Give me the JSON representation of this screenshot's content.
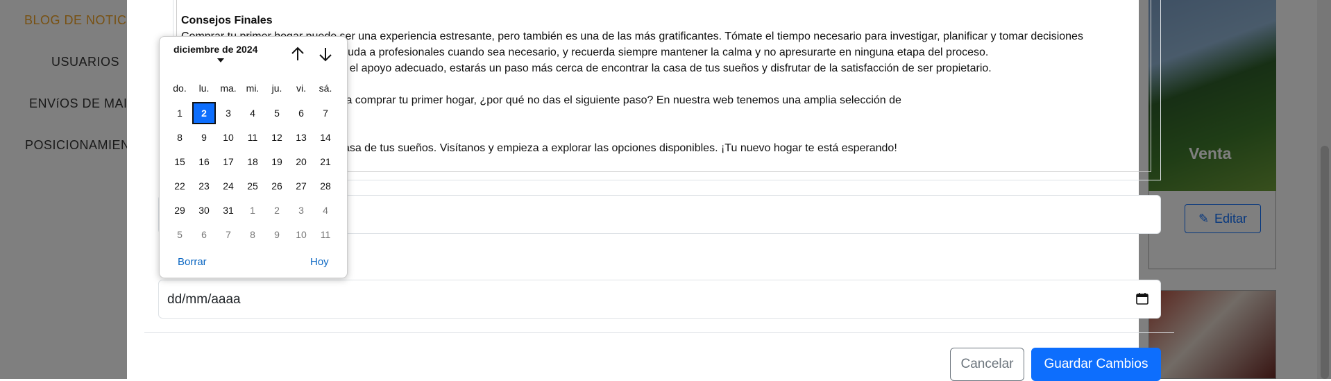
{
  "sidebar": {
    "items": [
      {
        "label": "BLOG DE NOTICIAS",
        "active": true
      },
      {
        "label": "USUARIOS",
        "active": false
      },
      {
        "label": "ENVíOS DE MAIL",
        "active": false
      },
      {
        "label": "POSICIONAMIENTO",
        "active": false
      }
    ]
  },
  "card": {
    "caption": "Venta",
    "edit_label": "Editar"
  },
  "editor": {
    "heading": "Consejos Finales",
    "lines": [
      "Comprar tu primer hogar puede ser una experiencia estresante, pero también es una de las más gratificantes. Tómate el tiempo necesario para investigar, planificar y tomar decisiones",
      "informadas. No dudes en pedir ayuda a profesionales cuando sea necesario, y recuerda siempre mantener la calma y no apresurarte en ninguna etapa del proceso.",
      "Con la información correcta y con el apoyo adecuado, estarás un paso más cerca de encontrar la casa de tus sueños y disfrutar de la satisfacción de ser propietario.",
      "",
      "Si estás listo para dar el paso para comprar tu primer hogar, ¿por qué no das el siguiente paso? En nuestra web tenemos una amplia selección de",
      "",
      "",
      "propiedades que podrían ser la casa de tus sueños. Visítanos y empieza a explorar las opciones disponibles. ¡Tu nuevo hogar te está esperando!"
    ]
  },
  "date_field": {
    "placeholder": "dd/mm/aaaa"
  },
  "footer": {
    "cancel_label": "Cancelar",
    "save_label": "Guardar Cambios"
  },
  "datepicker": {
    "month_label": "diciembre de 2024",
    "weekdays": [
      "do.",
      "lu.",
      "ma.",
      "mi.",
      "ju.",
      "vi.",
      "sá."
    ],
    "weeks": [
      [
        "1",
        "2",
        "3",
        "4",
        "5",
        "6",
        "7"
      ],
      [
        "8",
        "9",
        "10",
        "11",
        "12",
        "13",
        "14"
      ],
      [
        "15",
        "16",
        "17",
        "18",
        "19",
        "20",
        "21"
      ],
      [
        "22",
        "23",
        "24",
        "25",
        "26",
        "27",
        "28"
      ],
      [
        "29",
        "30",
        "31",
        "1",
        "2",
        "3",
        "4"
      ],
      [
        "5",
        "6",
        "7",
        "8",
        "9",
        "10",
        "11"
      ]
    ],
    "selected_day": "2",
    "clear_label": "Borrar",
    "today_label": "Hoy"
  },
  "colors": {
    "accent": "#0d6efd",
    "sidebar_active": "#f0a224"
  }
}
